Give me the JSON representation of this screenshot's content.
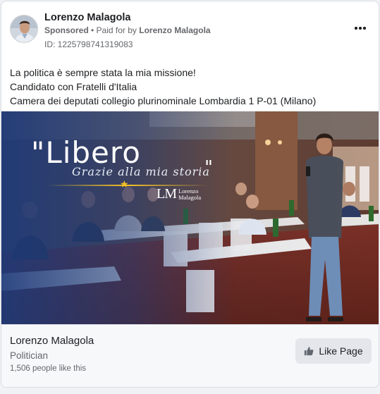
{
  "post": {
    "author_name": "Lorenzo Malagola",
    "sponsored_label": "Sponsored",
    "separator": " • ",
    "paid_for_label": "Paid for by ",
    "paid_for_name": "Lorenzo Malagola",
    "ad_id": "ID: 1225798741319083",
    "more_icon": "more-horizontal-icon",
    "text_lines": [
      "La politica è sempre stata la mia missione!",
      "Candidato con Fratelli d'Italia",
      "Camera dei deputati collegio plurinominale Lombardia 1 P-01 (Milano)"
    ]
  },
  "media": {
    "headline": "\"Libero",
    "subline": "Grazie alla mia storia",
    "close_quote": "\"",
    "logo_initials": "LM",
    "logo_name_line1": "Lorenzo",
    "logo_name_line2": "Malagola",
    "overlay_color": "#1d3a7a"
  },
  "footer": {
    "page_name": "Lorenzo Malagola",
    "page_category": "Politician",
    "page_likes": "1,506 people like this",
    "like_button_label": "Like Page",
    "like_icon": "thumbs-up-icon"
  }
}
